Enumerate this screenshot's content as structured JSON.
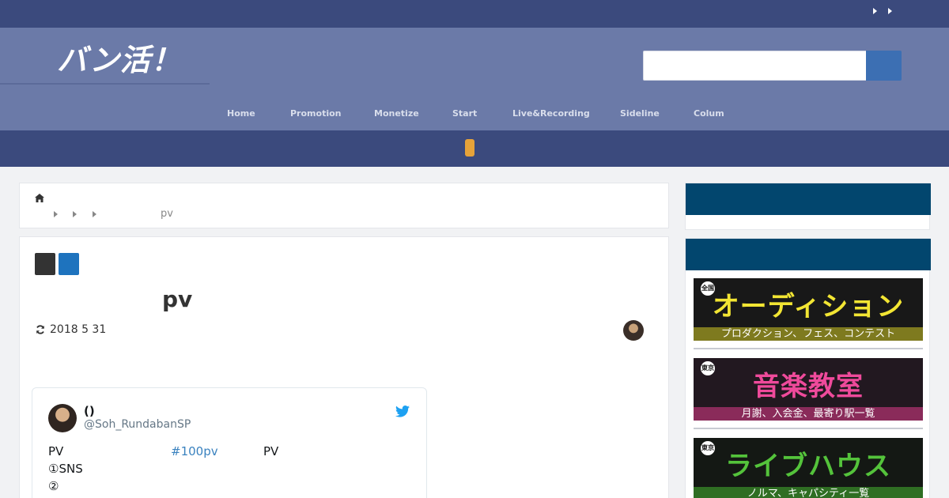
{
  "site": {
    "logo_text": "バン活！",
    "search": {
      "placeholder": ""
    }
  },
  "nav": {
    "items": [
      {
        "label": "Home"
      },
      {
        "label": "Promotion"
      },
      {
        "label": "Monetize"
      },
      {
        "label": "Start"
      },
      {
        "label": "Live&Recording"
      },
      {
        "label": "Sideline"
      },
      {
        "label": "Colum"
      }
    ]
  },
  "breadcrumb": {
    "current": "pv"
  },
  "article": {
    "title": "pv",
    "updated_date": "2018  5  31"
  },
  "tweet": {
    "name": "()",
    "handle": "@Soh_RundabanSP",
    "line1_prefix": "PV",
    "hashtag": "#100pv",
    "line1_suffix": "PV",
    "line2": "①SNS",
    "line3": "②"
  },
  "sidebar": {
    "banners": [
      {
        "title": "オーディション",
        "subtitle": "プロダクション、フェス、コンテスト",
        "badge": "全国",
        "title_color": "#f2e533",
        "sub_color": "#7e7a1f"
      },
      {
        "title": "音楽教室",
        "subtitle": "月謝、入会金、最寄り駅一覧",
        "badge": "東京",
        "title_color": "#ef4a9b",
        "sub_color": "#8a2b5a"
      },
      {
        "title": "ライブハウス",
        "subtitle": "ノルマ、キャパシティ一覧",
        "badge": "東京",
        "title_color": "#54c33b",
        "sub_color": "#2f6e23"
      }
    ]
  },
  "colors": {
    "topbar": "#3b4a7d",
    "header": "#6b7aa8",
    "sidebar_band": "#02466e",
    "search_button": "#3c6fb3",
    "accent_pill": "#e6a33a"
  }
}
